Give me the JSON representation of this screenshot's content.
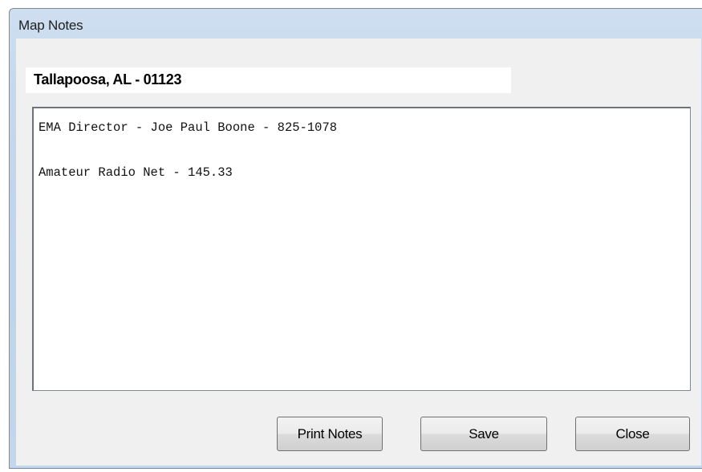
{
  "window": {
    "title": "Map Notes"
  },
  "location": {
    "value": "Tallapoosa, AL - 01123"
  },
  "notes": {
    "text": "EMA Director - Joe Paul Boone - 825-1078\n\nAmateur Radio Net - 145.33"
  },
  "buttons": {
    "print_label": "Print Notes",
    "save_label": "Save",
    "close_label": "Close"
  }
}
